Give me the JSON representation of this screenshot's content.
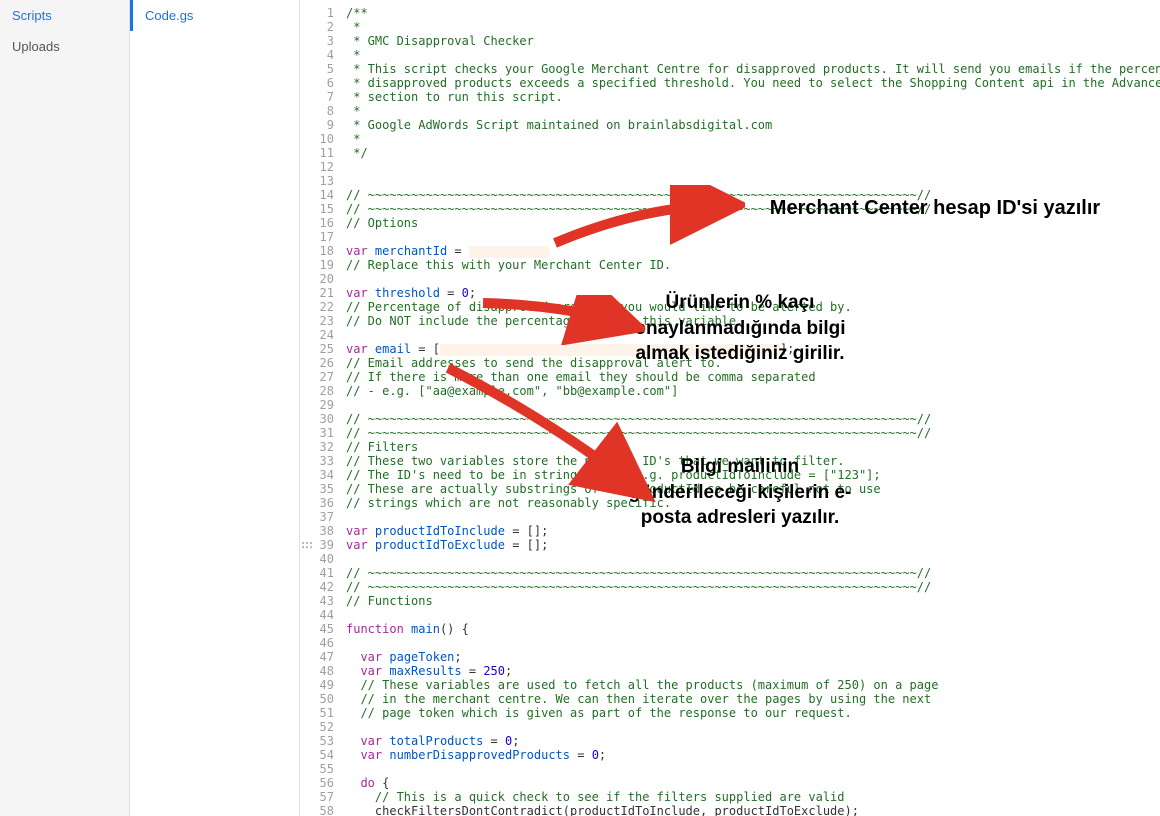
{
  "sidebar": {
    "items": [
      {
        "label": "Scripts",
        "active": true
      },
      {
        "label": "Uploads",
        "active": false
      }
    ]
  },
  "filelist": {
    "items": [
      {
        "label": "Code.gs",
        "active": true
      }
    ]
  },
  "annotations": {
    "a1": "Merchant Center hesap ID'si yazılır",
    "a2": "Ürünlerin % kaçı onaylanmadığında bilgi almak istediğiniz girilir.",
    "a3": "Bilgi mailinin gönderileceği kişilerin e-posta adresleri yazılır."
  },
  "code": {
    "lines": [
      {
        "n": 1,
        "t": "comment",
        "text": "/**"
      },
      {
        "n": 2,
        "t": "comment",
        "text": " *"
      },
      {
        "n": 3,
        "t": "comment",
        "text": " * GMC Disapproval Checker"
      },
      {
        "n": 4,
        "t": "comment",
        "text": " *"
      },
      {
        "n": 5,
        "t": "comment",
        "text": " * This script checks your Google Merchant Centre for disapproved products. It will send you emails if the percentage of"
      },
      {
        "n": 6,
        "t": "comment",
        "text": " * disapproved products exceeds a specified threshold. You need to select the Shopping Content api in the Advanced Apis"
      },
      {
        "n": 7,
        "t": "comment",
        "text": " * section to run this script."
      },
      {
        "n": 8,
        "t": "comment",
        "text": " *"
      },
      {
        "n": 9,
        "t": "comment",
        "text": " * Google AdWords Script maintained on brainlabsdigital.com"
      },
      {
        "n": 10,
        "t": "comment",
        "text": " *"
      },
      {
        "n": 11,
        "t": "comment",
        "text": " */"
      },
      {
        "n": 12,
        "t": "blank",
        "text": ""
      },
      {
        "n": 13,
        "t": "blank",
        "text": ""
      },
      {
        "n": 14,
        "t": "comment",
        "text": "// ~~~~~~~~~~~~~~~~~~~~~~~~~~~~~~~~~~~~~~~~~~~~~~~~~~~~~~~~~~~~~~~~~~~~~~~~~~~~//"
      },
      {
        "n": 15,
        "t": "comment",
        "text": "// ~~~~~~~~~~~~~~~~~~~~~~~~~~~~~~~~~~~~~~~~~~~~~~~~~~~~~~~~~~~~~~~~~~~~~~~~~~~~//"
      },
      {
        "n": 16,
        "t": "comment",
        "text": "// Options"
      },
      {
        "n": 17,
        "t": "blank",
        "text": ""
      },
      {
        "n": 18,
        "t": "var-hl",
        "kw": "var",
        "name": "merchantId",
        "eq": " = ",
        "hlw": 80
      },
      {
        "n": 19,
        "t": "comment",
        "text": "// Replace this with your Merchant Center ID."
      },
      {
        "n": 20,
        "t": "blank",
        "text": ""
      },
      {
        "n": 21,
        "t": "var-num",
        "kw": "var",
        "name": "threshold",
        "eq": " = ",
        "num": "0",
        "tail": ";"
      },
      {
        "n": 22,
        "t": "comment",
        "text": "// Percentage of disapproved products you would like to be alerted by."
      },
      {
        "n": 23,
        "t": "comment",
        "text": "// Do NOT include the percentage sign in this variable."
      },
      {
        "n": 24,
        "t": "blank",
        "text": ""
      },
      {
        "n": 25,
        "t": "var-hl2",
        "kw": "var",
        "name": "email",
        "eq": " = [",
        "hlw": 340,
        "tail": "];"
      },
      {
        "n": 26,
        "t": "comment",
        "text": "// Email addresses to send the disapproval alert to."
      },
      {
        "n": 27,
        "t": "comment",
        "text": "// If there is more than one email they should be comma separated"
      },
      {
        "n": 28,
        "t": "comment",
        "text": "// - e.g. [\"aa@example.com\", \"bb@example.com\"]"
      },
      {
        "n": 29,
        "t": "blank",
        "text": ""
      },
      {
        "n": 30,
        "t": "comment",
        "text": "// ~~~~~~~~~~~~~~~~~~~~~~~~~~~~~~~~~~~~~~~~~~~~~~~~~~~~~~~~~~~~~~~~~~~~~~~~~~~~//"
      },
      {
        "n": 31,
        "t": "comment",
        "text": "// ~~~~~~~~~~~~~~~~~~~~~~~~~~~~~~~~~~~~~~~~~~~~~~~~~~~~~~~~~~~~~~~~~~~~~~~~~~~~//"
      },
      {
        "n": 32,
        "t": "comment",
        "text": "// Filters"
      },
      {
        "n": 33,
        "t": "comment",
        "text": "// These two variables store the product ID's that we want to filter."
      },
      {
        "n": 34,
        "t": "comment",
        "text": "// The ID's need to be in string format e.g. productIdToInclude = [\"123\"];"
      },
      {
        "n": 35,
        "t": "comment",
        "text": "// These are actually substrings of the productId so be careful not to use"
      },
      {
        "n": 36,
        "t": "comment",
        "text": "// strings which are not reasonably specific."
      },
      {
        "n": 37,
        "t": "blank",
        "text": ""
      },
      {
        "n": 38,
        "t": "var-arr",
        "kw": "var",
        "name": "productIdToInclude",
        "eq": " = [];",
        "tail": ""
      },
      {
        "n": 39,
        "t": "var-arr",
        "kw": "var",
        "name": "productIdToExclude",
        "eq": " = [];",
        "tail": ""
      },
      {
        "n": 40,
        "t": "blank",
        "text": ""
      },
      {
        "n": 41,
        "t": "comment",
        "text": "// ~~~~~~~~~~~~~~~~~~~~~~~~~~~~~~~~~~~~~~~~~~~~~~~~~~~~~~~~~~~~~~~~~~~~~~~~~~~~//"
      },
      {
        "n": 42,
        "t": "comment",
        "text": "// ~~~~~~~~~~~~~~~~~~~~~~~~~~~~~~~~~~~~~~~~~~~~~~~~~~~~~~~~~~~~~~~~~~~~~~~~~~~~//"
      },
      {
        "n": 43,
        "t": "comment",
        "text": "// Functions"
      },
      {
        "n": 44,
        "t": "blank",
        "text": ""
      },
      {
        "n": 45,
        "t": "func",
        "kw": "function",
        "name": "main",
        "tail": "() {"
      },
      {
        "n": 46,
        "t": "blank",
        "text": ""
      },
      {
        "n": 47,
        "t": "var-plain",
        "kw": "var",
        "name": "pageToken",
        "tail": ";",
        "ind": "  "
      },
      {
        "n": 48,
        "t": "var-num",
        "kw": "var",
        "name": "maxResults",
        "eq": " = ",
        "num": "250",
        "tail": ";",
        "ind": "  "
      },
      {
        "n": 49,
        "t": "comment",
        "text": "  // These variables are used to fetch all the products (maximum of 250) on a page"
      },
      {
        "n": 50,
        "t": "comment",
        "text": "  // in the merchant centre. We can then iterate over the pages by using the next"
      },
      {
        "n": 51,
        "t": "comment",
        "text": "  // page token which is given as part of the response to our request."
      },
      {
        "n": 52,
        "t": "blank",
        "text": ""
      },
      {
        "n": 53,
        "t": "var-num",
        "kw": "var",
        "name": "totalProducts",
        "eq": " = ",
        "num": "0",
        "tail": ";",
        "ind": "  "
      },
      {
        "n": 54,
        "t": "var-num",
        "kw": "var",
        "name": "numberDisapprovedProducts",
        "eq": " = ",
        "num": "0",
        "tail": ";",
        "ind": "  "
      },
      {
        "n": 55,
        "t": "blank",
        "text": ""
      },
      {
        "n": 56,
        "t": "raw",
        "text": "  do {",
        "kwpos": [
          2,
          4
        ]
      },
      {
        "n": 57,
        "t": "comment",
        "text": "    // This is a quick check to see if the filters supplied are valid"
      },
      {
        "n": 58,
        "t": "plain",
        "text": "    checkFiltersDontContradict(productIdToInclude, productIdToExclude);"
      }
    ]
  }
}
